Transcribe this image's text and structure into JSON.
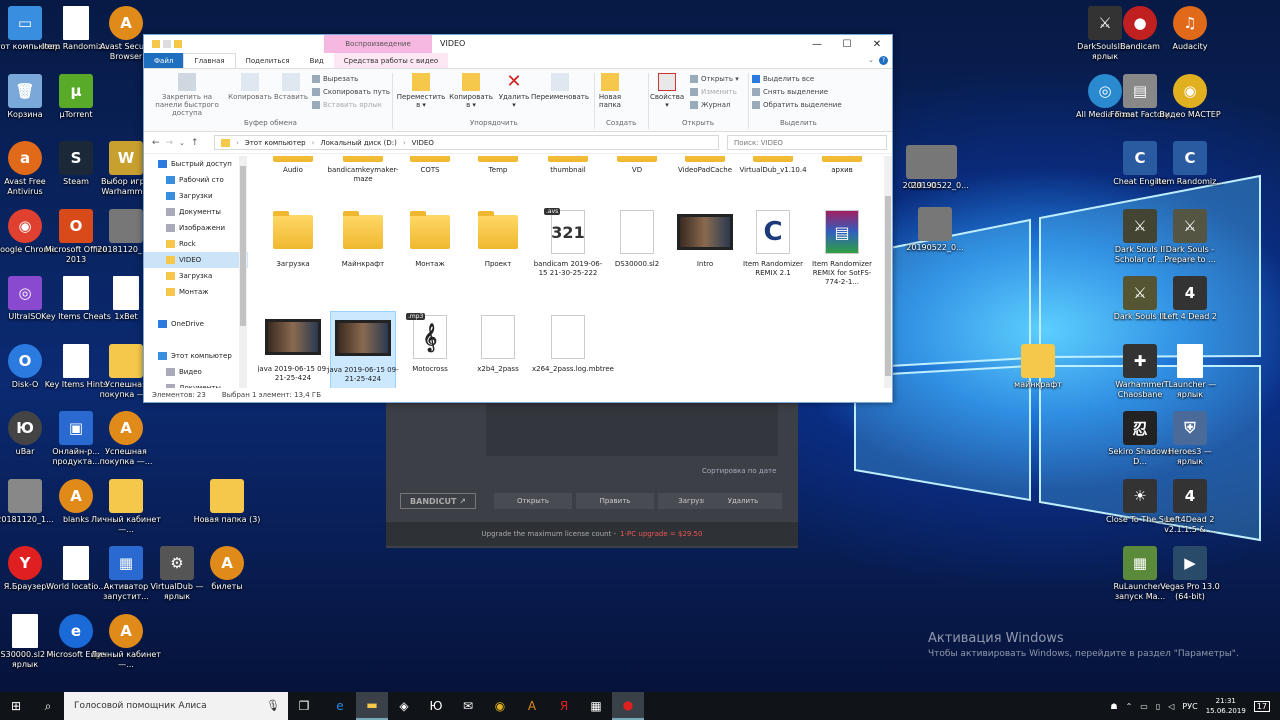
{
  "desktop": {
    "icons_left": [
      {
        "label": "Этот компьютер",
        "icon": "pc-icon",
        "c": "#3a8ee0",
        "g": "▭"
      },
      {
        "label": "Item Randomiz...",
        "icon": "document-icon",
        "c": "#fff",
        "g": ""
      },
      {
        "label": "Avast Secure Browser",
        "icon": "avast-browser-icon",
        "c": "#e08a1a",
        "g": "A"
      },
      {
        "label": "Корзина",
        "icon": "recycle-bin-icon",
        "c": "#7aa8d8",
        "g": "🗑"
      },
      {
        "label": "µTorrent",
        "icon": "utorrent-icon",
        "c": "#5aaa2a",
        "g": "µ"
      },
      {
        "label": "Avast Free Antivirus",
        "icon": "avast-icon",
        "c": "#e06a1a",
        "g": "a"
      },
      {
        "label": "Steam",
        "icon": "steam-icon",
        "c": "#1b2838",
        "g": "S"
      },
      {
        "label": "Выбор игры Warhammer",
        "icon": "warhammer-icon",
        "c": "#c8a030",
        "g": "W"
      },
      {
        "label": "Google Chrome",
        "icon": "chrome-icon",
        "c": "#e04030",
        "g": "◉"
      },
      {
        "label": "Microsoft Office 2013",
        "icon": "office-icon",
        "c": "#d84a1a",
        "g": "O"
      },
      {
        "label": "20181120_1...",
        "icon": "image-icon",
        "c": "#777",
        "g": ""
      },
      {
        "label": "UltraISO",
        "icon": "ultraiso-icon",
        "c": "#8a4ad0",
        "g": "◎"
      },
      {
        "label": "Key Items Cheats",
        "icon": "document-icon",
        "c": "#fff",
        "g": ""
      },
      {
        "label": "1xBet",
        "icon": "document-icon",
        "c": "#fff",
        "g": ""
      },
      {
        "label": "Disk-O",
        "icon": "disko-icon",
        "c": "#2a7ae0",
        "g": "O"
      },
      {
        "label": "Key Items Hints",
        "icon": "document-icon",
        "c": "#fff",
        "g": ""
      },
      {
        "label": "Успешная покупка —...",
        "icon": "folder-doc-icon",
        "c": "#f5c84c",
        "g": ""
      },
      {
        "label": "uBar",
        "icon": "ubar-icon",
        "c": "#444",
        "g": "Ю"
      },
      {
        "label": "Онлайн-р... продукта...",
        "icon": "asus-icon",
        "c": "#2a6ad0",
        "g": "▣"
      },
      {
        "label": "Успешная покупка —...",
        "icon": "avast-browser-icon",
        "c": "#e08a1a",
        "g": "A"
      },
      {
        "label": "20181120_1...",
        "icon": "image-icon",
        "c": "#888",
        "g": ""
      },
      {
        "label": "blanks",
        "icon": "avast-browser-icon",
        "c": "#e08a1a",
        "g": "A"
      },
      {
        "label": "Личный кабинет —...",
        "icon": "folder-doc-icon",
        "c": "#f5c84c",
        "g": ""
      },
      {
        "label": "Новая папка (3)",
        "icon": "folder-icon",
        "c": "#f5c84c",
        "g": ""
      },
      {
        "label": "Я.Браузер",
        "icon": "yandex-icon",
        "c": "#e02020",
        "g": "Y"
      },
      {
        "label": "World locatio...",
        "icon": "document-icon",
        "c": "#fff",
        "g": ""
      },
      {
        "label": "Активатор запустит...",
        "icon": "activator-icon",
        "c": "#2a6ad0",
        "g": "▦"
      },
      {
        "label": "VirtualDub — ярлык",
        "icon": "virtualdub-icon",
        "c": "#555",
        "g": "⚙"
      },
      {
        "label": "билеты",
        "icon": "avast-browser-icon",
        "c": "#e08a1a",
        "g": "A"
      },
      {
        "label": "DS30000.sl2 — ярлык",
        "icon": "document-icon",
        "c": "#fff",
        "g": ""
      },
      {
        "label": "Microsoft Edge",
        "icon": "edge-icon",
        "c": "#1a6ad8",
        "g": "e"
      },
      {
        "label": "Личный кабинет —...",
        "icon": "avast-browser-icon",
        "c": "#e08a1a",
        "g": "A"
      }
    ],
    "icons_right": [
      {
        "label": "DarkSoulsII — ярлык",
        "icon": "darksouls-icon",
        "c": "#333",
        "g": "⚔"
      },
      {
        "label": "Bandicam",
        "icon": "bandicam-icon",
        "c": "#c02020",
        "g": "●"
      },
      {
        "label": "Audacity",
        "icon": "audacity-icon",
        "c": "#e06a1a",
        "g": "♫"
      },
      {
        "label": "All Media Fixer",
        "icon": "mediafixer-icon",
        "c": "#2a8ad0",
        "g": "◎"
      },
      {
        "label": "Format Factory",
        "icon": "formatfactory-icon",
        "c": "#888",
        "g": "▤"
      },
      {
        "label": "Видео МАСТЕР",
        "icon": "videomaster-icon",
        "c": "#e0b020",
        "g": "◉"
      },
      {
        "label": "Cheat Engine",
        "icon": "cheatengine-icon",
        "c": "#2a5aa0",
        "g": "C"
      },
      {
        "label": "Item Randomiz...",
        "icon": "cheatengine-icon",
        "c": "#2a5aa0",
        "g": "C"
      },
      {
        "label": "Dark Souls II Scholar of ...",
        "icon": "darksouls-icon",
        "c": "#443",
        "g": "⚔"
      },
      {
        "label": "Dark Souls - Prepare to ...",
        "icon": "darksouls-icon",
        "c": "#554",
        "g": "⚔"
      },
      {
        "label": "Dark Souls III",
        "icon": "darksouls-icon",
        "c": "#553",
        "g": "⚔"
      },
      {
        "label": "Left 4 Dead 2",
        "icon": "l4d2-icon",
        "c": "#333",
        "g": "4"
      },
      {
        "label": "Warhammer Chaosbane",
        "icon": "warhammer-icon",
        "c": "#333",
        "g": "✚"
      },
      {
        "label": "TLauncher — ярлык",
        "icon": "document-icon",
        "c": "#fff",
        "g": ""
      },
      {
        "label": "Sekiro Shadows D...",
        "icon": "sekiro-icon",
        "c": "#222",
        "g": "忍"
      },
      {
        "label": "Heroes3 — ярлык",
        "icon": "heroes-icon",
        "c": "#4a6a9a",
        "g": "⛨"
      },
      {
        "label": "Close To The Sun",
        "icon": "game-icon",
        "c": "#333",
        "g": "☀"
      },
      {
        "label": "Left4Dead 2 v2.1.1.5 & ...",
        "icon": "l4d2-icon",
        "c": "#333",
        "g": "4"
      },
      {
        "label": "RuLauncher - запуск Ма...",
        "icon": "minecraft-icon",
        "c": "#5a8a3a",
        "g": "▦"
      },
      {
        "label": "Vegas Pro 13.0 (64-bit)",
        "icon": "vegas-icon",
        "c": "#2a4a6a",
        "g": "▶"
      }
    ],
    "misc": [
      {
        "label": "майнкрафт",
        "icon": "folder-icon",
        "c": "#f5c84c"
      },
      {
        "label": "2019...0...",
        "icon": "image-icon",
        "c": "#777"
      },
      {
        "label": "20190522_0...",
        "icon": "image-icon",
        "c": "#777"
      },
      {
        "label": "20190522_0...",
        "icon": "image-icon",
        "c": "#777"
      }
    ],
    "watermark_title": "Активация Windows",
    "watermark_text": "Чтобы активировать Windows, перейдите в раздел \"Параметры\"."
  },
  "bandicut": {
    "sort_label": "Сортировка по дате",
    "logo": "BANDICUT ↗",
    "buttons": [
      "Открыть",
      "Править",
      "Загрузить",
      "Удалить"
    ],
    "footer_text": "Upgrade the maximum license count -",
    "footer_offer": "1-PC upgrade = $29.50"
  },
  "explorer": {
    "context_group": "Воспроизведение",
    "title": "VIDEO",
    "controls": {
      "minimize": "—",
      "maximize": "☐",
      "close": "✕"
    },
    "tabs": [
      "Файл",
      "Главная",
      "Поделиться",
      "Вид",
      "Средства работы с видео"
    ],
    "ribbon": {
      "pin": "Закрепить на панели быстрого доступа",
      "copy": "Копировать",
      "paste": "Вставить",
      "cut": "Вырезать",
      "copy_path": "Скопировать путь",
      "paste_shortcut": "Вставить ярлык",
      "move_to": "Переместить в ▾",
      "copy_to": "Копировать в ▾",
      "delete": "Удалить ▾",
      "rename": "Переименовать",
      "new_folder": "Новая папка",
      "properties": "Свойства ▾",
      "open": "Открыть ▾",
      "edit": "Изменить",
      "history": "Журнал",
      "select_all": "Выделить все",
      "select_none": "Снять выделение",
      "invert": "Обратить выделение",
      "groups": [
        "Буфер обмена",
        "Упорядочить",
        "Создать",
        "Открыть",
        "Выделить"
      ]
    },
    "address": [
      "Этот компьютер",
      "Локальный диск (D:)",
      "VIDEO"
    ],
    "search_placeholder": "Поиск: VIDEO",
    "nav_items": [
      {
        "label": "Быстрый доступ",
        "pin": "",
        "sel": false,
        "indent": 0,
        "c": "#2a7ae0"
      },
      {
        "label": "Рабочий сто",
        "pin": "✱",
        "sel": false,
        "indent": 1,
        "c": "#3a8ee0"
      },
      {
        "label": "Загрузки",
        "pin": "✱",
        "sel": false,
        "indent": 1,
        "c": "#3a8ee0"
      },
      {
        "label": "Документы",
        "pin": "✱",
        "sel": false,
        "indent": 1,
        "c": "#aab"
      },
      {
        "label": "Изображени",
        "pin": "✱",
        "sel": false,
        "indent": 1,
        "c": "#aab"
      },
      {
        "label": "Rock",
        "pin": "",
        "sel": false,
        "indent": 1,
        "c": "#f5c84c"
      },
      {
        "label": "VIDEO",
        "pin": "",
        "sel": true,
        "indent": 1,
        "c": "#f5c84c"
      },
      {
        "label": "Загрузка",
        "pin": "",
        "sel": false,
        "indent": 1,
        "c": "#f5c84c"
      },
      {
        "label": "Монтаж",
        "pin": "",
        "sel": false,
        "indent": 1,
        "c": "#f5c84c"
      },
      {
        "label": "",
        "pin": "",
        "sel": false,
        "indent": 0,
        "c": "transparent"
      },
      {
        "label": "OneDrive",
        "pin": "",
        "sel": false,
        "indent": 0,
        "c": "#2a7ae0"
      },
      {
        "label": "",
        "pin": "",
        "sel": false,
        "indent": 0,
        "c": "transparent"
      },
      {
        "label": "Этот компьютер",
        "pin": "",
        "sel": false,
        "indent": 0,
        "c": "#3a8ee0"
      },
      {
        "label": "Видео",
        "pin": "",
        "sel": false,
        "indent": 1,
        "c": "#aab"
      },
      {
        "label": "Документы",
        "pin": "",
        "sel": false,
        "indent": 1,
        "c": "#aab"
      }
    ],
    "files_row0": [
      "Audio",
      "bandicamkeymaker-maze",
      "COTS",
      "Temp",
      "thumbnail",
      "VD",
      "VideoPadCache",
      "VirtualDub_v1.10.4",
      "архив"
    ],
    "files_row1": [
      {
        "label": "Загрузка",
        "kind": "folder"
      },
      {
        "label": "Майнкрафт",
        "kind": "folder"
      },
      {
        "label": "Монтаж",
        "kind": "folder"
      },
      {
        "label": "Проект",
        "kind": "folder"
      },
      {
        "label": "bandicam 2019-06-15 21-30-25-222",
        "kind": "avs",
        "badge": ".avs",
        "g": "321"
      },
      {
        "label": "DS30000.sl2",
        "kind": "doc"
      },
      {
        "label": "Intro",
        "kind": "video"
      },
      {
        "label": "Item Randomizer REMIX 2.1",
        "kind": "cheat",
        "g": "C"
      },
      {
        "label": "Item Randomizer REMIX for SotFS-774-2-1...",
        "kind": "rar",
        "g": "▤"
      }
    ],
    "files_row2": [
      {
        "label": "java 2019-06-15 09-21-25-424",
        "kind": "video",
        "sel": false
      },
      {
        "label": "java 2019-06-15 09-21-25-424",
        "kind": "video",
        "sel": true
      },
      {
        "label": "Motocross",
        "kind": "mp3",
        "badge": ".mp3",
        "g": "𝄞"
      },
      {
        "label": "x2b4_2pass",
        "kind": "doc"
      },
      {
        "label": "x264_2pass.log.mbtree",
        "kind": "doc"
      }
    ],
    "status": {
      "count": "Элементов: 23",
      "selected": "Выбран 1 элемент: 13,4 ГБ"
    }
  },
  "taskbar": {
    "search": "Голосовой помощник Алиса",
    "apps": [
      {
        "name": "edge-icon",
        "g": "e",
        "c": "#2a8ae0",
        "act": false
      },
      {
        "name": "explorer-icon",
        "g": "▬",
        "c": "#f5c84c",
        "act": true
      },
      {
        "name": "store-icon",
        "g": "◈",
        "c": "#fff",
        "act": false
      },
      {
        "name": "ubar-icon",
        "g": "Ю",
        "c": "#fff",
        "act": false
      },
      {
        "name": "mail-icon",
        "g": "✉",
        "c": "#fff",
        "act": false
      },
      {
        "name": "chrome-icon",
        "g": "◉",
        "c": "#e0b020",
        "act": false
      },
      {
        "name": "avast-browser-icon",
        "g": "A",
        "c": "#e08a1a",
        "act": false
      },
      {
        "name": "yandex-icon",
        "g": "Я",
        "c": "#e02020",
        "act": false
      },
      {
        "name": "calculator-icon",
        "g": "▦",
        "c": "#fff",
        "act": false
      },
      {
        "name": "bandicam-icon",
        "g": "●",
        "c": "#e02020",
        "act": true
      }
    ],
    "lang": "РУС",
    "time": "21:31",
    "date": "15.06.2019",
    "notif": "17"
  }
}
